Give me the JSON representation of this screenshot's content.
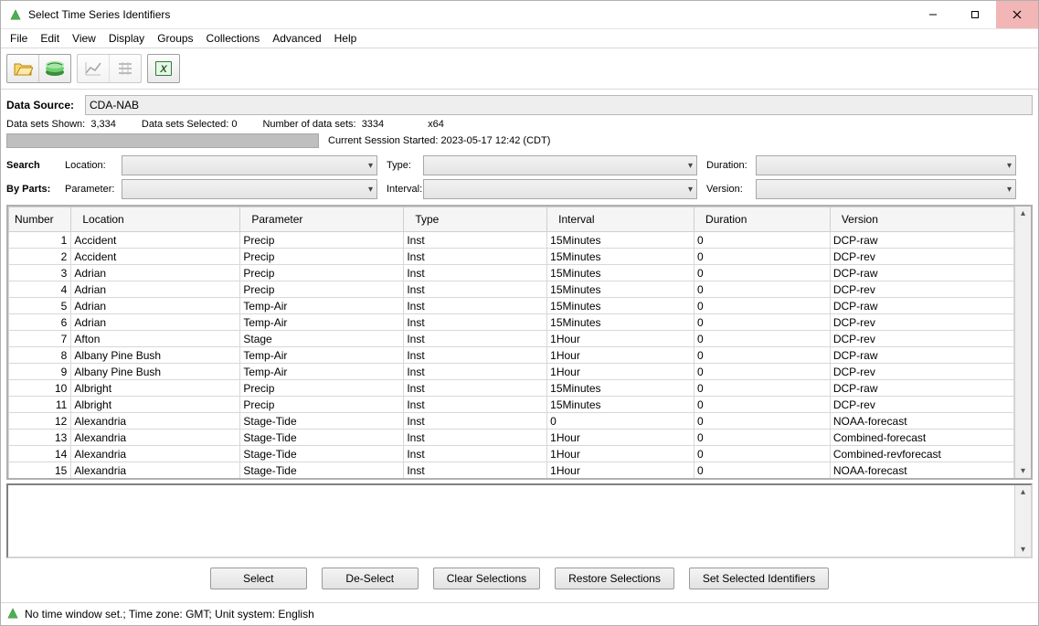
{
  "window": {
    "title": "Select Time Series Identifiers"
  },
  "menu": {
    "items": [
      "File",
      "Edit",
      "View",
      "Display",
      "Groups",
      "Collections",
      "Advanced",
      "Help"
    ]
  },
  "toolbar": {
    "icons": [
      "open-file-icon",
      "map-layers-icon",
      "chart-icon",
      "table-align-icon",
      "export-excel-icon"
    ]
  },
  "data_source": {
    "label": "Data Source:",
    "value": "CDA-NAB"
  },
  "stats": {
    "shown_label": "Data sets Shown:",
    "shown_value": "3,334",
    "selected_label": "Data sets Selected:",
    "selected_value": "0",
    "total_label": "Number of data sets:",
    "total_value": "3334",
    "arch": "x64"
  },
  "session": {
    "label": "Current Session Started:",
    "started": "2023-05-17 12:42 (CDT)"
  },
  "search": {
    "row1_label": "Search",
    "row2_label": "By Parts:",
    "fields": {
      "location": {
        "label": "Location:"
      },
      "type": {
        "label": "Type:"
      },
      "duration": {
        "label": "Duration:"
      },
      "parameter": {
        "label": "Parameter:"
      },
      "interval": {
        "label": "Interval:"
      },
      "version": {
        "label": "Version:"
      }
    }
  },
  "table": {
    "headers": {
      "number": "Number",
      "location": "Location",
      "parameter": "Parameter",
      "type": "Type",
      "interval": "Interval",
      "duration": "Duration",
      "version": "Version"
    },
    "rows": [
      {
        "n": "1",
        "location": "Accident",
        "parameter": "Precip",
        "type": "Inst",
        "interval": "15Minutes",
        "duration": "0",
        "version": "DCP-raw"
      },
      {
        "n": "2",
        "location": "Accident",
        "parameter": "Precip",
        "type": "Inst",
        "interval": "15Minutes",
        "duration": "0",
        "version": "DCP-rev"
      },
      {
        "n": "3",
        "location": "Adrian",
        "parameter": "Precip",
        "type": "Inst",
        "interval": "15Minutes",
        "duration": "0",
        "version": "DCP-raw"
      },
      {
        "n": "4",
        "location": "Adrian",
        "parameter": "Precip",
        "type": "Inst",
        "interval": "15Minutes",
        "duration": "0",
        "version": "DCP-rev"
      },
      {
        "n": "5",
        "location": "Adrian",
        "parameter": "Temp-Air",
        "type": "Inst",
        "interval": "15Minutes",
        "duration": "0",
        "version": "DCP-raw"
      },
      {
        "n": "6",
        "location": "Adrian",
        "parameter": "Temp-Air",
        "type": "Inst",
        "interval": "15Minutes",
        "duration": "0",
        "version": "DCP-rev"
      },
      {
        "n": "7",
        "location": "Afton",
        "parameter": "Stage",
        "type": "Inst",
        "interval": "1Hour",
        "duration": "0",
        "version": "DCP-rev"
      },
      {
        "n": "8",
        "location": "Albany Pine Bush",
        "parameter": "Temp-Air",
        "type": "Inst",
        "interval": "1Hour",
        "duration": "0",
        "version": "DCP-raw"
      },
      {
        "n": "9",
        "location": "Albany Pine Bush",
        "parameter": "Temp-Air",
        "type": "Inst",
        "interval": "1Hour",
        "duration": "0",
        "version": "DCP-rev"
      },
      {
        "n": "10",
        "location": "Albright",
        "parameter": "Precip",
        "type": "Inst",
        "interval": "15Minutes",
        "duration": "0",
        "version": "DCP-raw"
      },
      {
        "n": "11",
        "location": "Albright",
        "parameter": "Precip",
        "type": "Inst",
        "interval": "15Minutes",
        "duration": "0",
        "version": "DCP-rev"
      },
      {
        "n": "12",
        "location": "Alexandria",
        "parameter": "Stage-Tide",
        "type": "Inst",
        "interval": "0",
        "duration": "0",
        "version": "NOAA-forecast"
      },
      {
        "n": "13",
        "location": "Alexandria",
        "parameter": "Stage-Tide",
        "type": "Inst",
        "interval": "1Hour",
        "duration": "0",
        "version": "Combined-forecast"
      },
      {
        "n": "14",
        "location": "Alexandria",
        "parameter": "Stage-Tide",
        "type": "Inst",
        "interval": "1Hour",
        "duration": "0",
        "version": "Combined-revforecast"
      },
      {
        "n": "15",
        "location": "Alexandria",
        "parameter": "Stage-Tide",
        "type": "Inst",
        "interval": "1Hour",
        "duration": "0",
        "version": "NOAA-forecast"
      }
    ]
  },
  "buttons": {
    "select": "Select",
    "deselect": "De-Select",
    "clear": "Clear Selections",
    "restore": "Restore Selections",
    "set": "Set Selected Identifiers"
  },
  "status": {
    "text": "No time window set.;  Time zone: GMT;  Unit system: English"
  }
}
